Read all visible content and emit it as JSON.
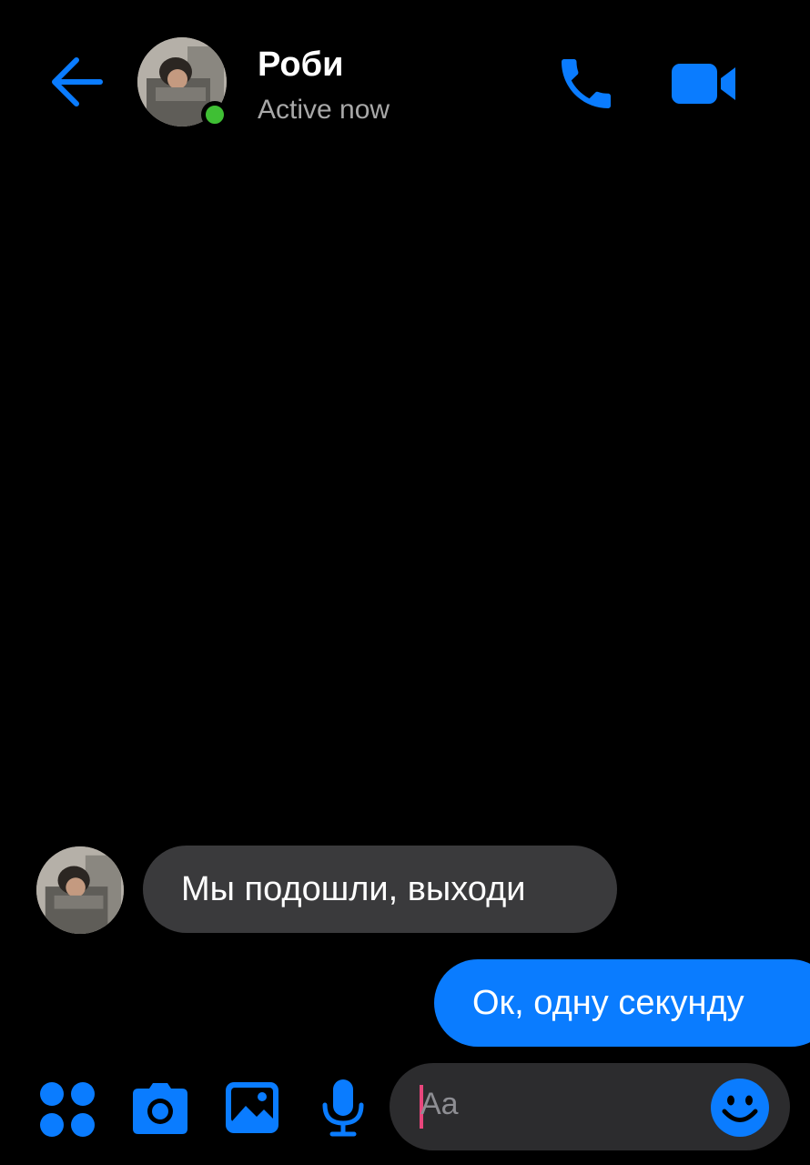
{
  "header": {
    "contact_name": "Роби",
    "status": "Active now",
    "back_icon": "arrow-left-icon",
    "call_icon": "phone-icon",
    "video_icon": "video-camera-icon",
    "online_indicator": "online-dot"
  },
  "messages": [
    {
      "direction": "incoming",
      "text": "Мы подошли, выходи"
    },
    {
      "direction": "outgoing",
      "text": "Ок, одну секунду"
    }
  ],
  "composer": {
    "placeholder": "Aa",
    "icons": [
      "apps-icon",
      "camera-icon",
      "image-icon",
      "microphone-icon",
      "emoji-icon"
    ]
  },
  "colors": {
    "accent": "#0a7cff",
    "incoming_bubble": "#3a3a3c",
    "background": "#000000",
    "online": "#3fbf34",
    "caret": "#e8467c"
  }
}
